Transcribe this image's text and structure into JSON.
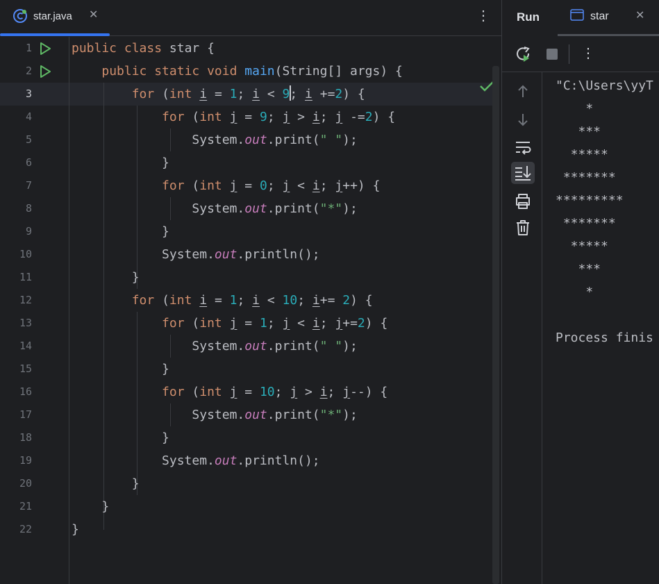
{
  "editor": {
    "tab": {
      "label": "star.java",
      "close": "✕",
      "icon": "java-class-icon"
    },
    "more_icon": "⋮",
    "line_numbers": [
      "1",
      "2",
      "3",
      "4",
      "5",
      "6",
      "7",
      "8",
      "9",
      "10",
      "11",
      "12",
      "13",
      "14",
      "15",
      "16",
      "17",
      "18",
      "19",
      "20",
      "21",
      "22"
    ],
    "current_line": 3,
    "lines": [
      [
        [
          "kw",
          "public "
        ],
        [
          "kw",
          "class "
        ],
        [
          "",
          "star {"
        ]
      ],
      [
        [
          "",
          "    "
        ],
        [
          "kw",
          "public "
        ],
        [
          "kw",
          "static "
        ],
        [
          "kw",
          "void "
        ],
        [
          "fn",
          "main"
        ],
        [
          "",
          "(String[] args) {"
        ]
      ],
      [
        [
          "",
          "        "
        ],
        [
          "kw",
          "for "
        ],
        [
          "",
          "("
        ],
        [
          "kw",
          "int "
        ],
        [
          "u",
          "i"
        ],
        [
          "",
          " = "
        ],
        [
          "num",
          "1"
        ],
        [
          "",
          "; "
        ],
        [
          "u",
          "i"
        ],
        [
          "",
          " < "
        ],
        [
          "num",
          "9"
        ],
        [
          "caret",
          ""
        ],
        [
          "",
          "; "
        ],
        [
          "u",
          "i"
        ],
        [
          "",
          " +="
        ],
        [
          "num",
          "2"
        ],
        [
          "",
          ") {"
        ]
      ],
      [
        [
          "",
          "            "
        ],
        [
          "kw",
          "for "
        ],
        [
          "",
          "("
        ],
        [
          "kw",
          "int "
        ],
        [
          "u",
          "j"
        ],
        [
          "",
          " = "
        ],
        [
          "num",
          "9"
        ],
        [
          "",
          "; "
        ],
        [
          "u",
          "j"
        ],
        [
          "",
          " > "
        ],
        [
          "u",
          "i"
        ],
        [
          "",
          "; "
        ],
        [
          "u",
          "j"
        ],
        [
          "",
          " -="
        ],
        [
          "num",
          "2"
        ],
        [
          "",
          ") {"
        ]
      ],
      [
        [
          "",
          "                System."
        ],
        [
          "fld",
          "out"
        ],
        [
          "",
          ".print("
        ],
        [
          "str",
          "\" \""
        ],
        [
          "",
          ");"
        ]
      ],
      [
        [
          "",
          "            }"
        ]
      ],
      [
        [
          "",
          "            "
        ],
        [
          "kw",
          "for "
        ],
        [
          "",
          "("
        ],
        [
          "kw",
          "int "
        ],
        [
          "u",
          "j"
        ],
        [
          "",
          " = "
        ],
        [
          "num",
          "0"
        ],
        [
          "",
          "; "
        ],
        [
          "u",
          "j"
        ],
        [
          "",
          " < "
        ],
        [
          "u",
          "i"
        ],
        [
          "",
          "; "
        ],
        [
          "u",
          "j"
        ],
        [
          "",
          "++) {"
        ]
      ],
      [
        [
          "",
          "                System."
        ],
        [
          "fld",
          "out"
        ],
        [
          "",
          ".print("
        ],
        [
          "str",
          "\"*\""
        ],
        [
          "",
          ");"
        ]
      ],
      [
        [
          "",
          "            }"
        ]
      ],
      [
        [
          "",
          "            System."
        ],
        [
          "fld",
          "out"
        ],
        [
          "",
          ".println();"
        ]
      ],
      [
        [
          "",
          "        }"
        ]
      ],
      [
        [
          "",
          "        "
        ],
        [
          "kw",
          "for "
        ],
        [
          "",
          "("
        ],
        [
          "kw",
          "int "
        ],
        [
          "u",
          "i"
        ],
        [
          "",
          " = "
        ],
        [
          "num",
          "1"
        ],
        [
          "",
          "; "
        ],
        [
          "u",
          "i"
        ],
        [
          "",
          " < "
        ],
        [
          "num",
          "10"
        ],
        [
          "",
          "; "
        ],
        [
          "u",
          "i"
        ],
        [
          "",
          "+= "
        ],
        [
          "num",
          "2"
        ],
        [
          "",
          ") {"
        ]
      ],
      [
        [
          "",
          "            "
        ],
        [
          "kw",
          "for "
        ],
        [
          "",
          "("
        ],
        [
          "kw",
          "int "
        ],
        [
          "u",
          "j"
        ],
        [
          "",
          " = "
        ],
        [
          "num",
          "1"
        ],
        [
          "",
          "; "
        ],
        [
          "u",
          "j"
        ],
        [
          "",
          " < "
        ],
        [
          "u",
          "i"
        ],
        [
          "",
          "; "
        ],
        [
          "u",
          "j"
        ],
        [
          "",
          "+="
        ],
        [
          "num",
          "2"
        ],
        [
          "",
          ") {"
        ]
      ],
      [
        [
          "",
          "                System."
        ],
        [
          "fld",
          "out"
        ],
        [
          "",
          ".print("
        ],
        [
          "str",
          "\" \""
        ],
        [
          "",
          ");"
        ]
      ],
      [
        [
          "",
          "            }"
        ]
      ],
      [
        [
          "",
          "            "
        ],
        [
          "kw",
          "for "
        ],
        [
          "",
          "("
        ],
        [
          "kw",
          "int "
        ],
        [
          "u",
          "j"
        ],
        [
          "",
          " = "
        ],
        [
          "num",
          "10"
        ],
        [
          "",
          "; "
        ],
        [
          "u",
          "j"
        ],
        [
          "",
          " > "
        ],
        [
          "u",
          "i"
        ],
        [
          "",
          "; "
        ],
        [
          "u",
          "j"
        ],
        [
          "",
          "--) {"
        ]
      ],
      [
        [
          "",
          "                System."
        ],
        [
          "fld",
          "out"
        ],
        [
          "",
          ".print("
        ],
        [
          "str",
          "\"*\""
        ],
        [
          "",
          ");"
        ]
      ],
      [
        [
          "",
          "            }"
        ]
      ],
      [
        [
          "",
          "            System."
        ],
        [
          "fld",
          "out"
        ],
        [
          "",
          ".println();"
        ]
      ],
      [
        [
          "",
          "        }"
        ]
      ],
      [
        [
          "",
          "    }"
        ]
      ],
      [
        [
          "",
          "}"
        ]
      ]
    ],
    "colors": {
      "keyword": "#cf8e6d",
      "function": "#56a8f5",
      "number": "#2aacb8",
      "string": "#6aab73",
      "field": "#c77dbb",
      "accent": "#3574f0",
      "run": "#5fb865"
    }
  },
  "run_panel": {
    "title": "Run",
    "tab_label": "star",
    "tab_close": "✕",
    "toolbar": {
      "rerun": "rerun-icon",
      "stop": "stop-icon",
      "more": "⋮"
    },
    "side_tools": [
      "up-arrow-icon",
      "down-arrow-icon",
      "soft-wrap-icon",
      "scroll-to-end-icon",
      "print-icon",
      "trash-icon"
    ],
    "console_lines": [
      "\"C:\\Users\\yyT",
      "    *",
      "   ***",
      "  *****",
      " *******",
      "*********",
      " *******",
      "  *****",
      "   ***",
      "    *",
      "",
      "Process finis"
    ]
  }
}
